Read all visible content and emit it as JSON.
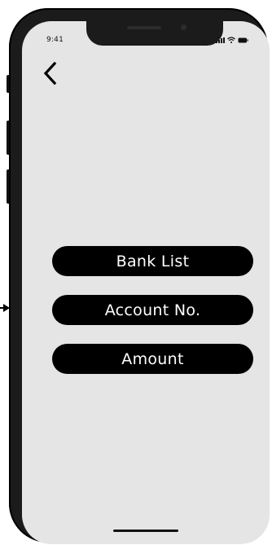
{
  "status_bar": {
    "time": "9:41",
    "icons": [
      "signal-icon",
      "wifi-icon",
      "battery-icon"
    ]
  },
  "nav": {
    "back_icon": "chevron-left-icon"
  },
  "form": {
    "bank_list_label": "Bank List",
    "account_no_label": "Account No.",
    "amount_label": "Amount"
  },
  "colors": {
    "screen_background": "#e5e5e5",
    "button_background": "#000000",
    "button_text": "#ffffff",
    "device_frame": "#1b1b1b"
  }
}
